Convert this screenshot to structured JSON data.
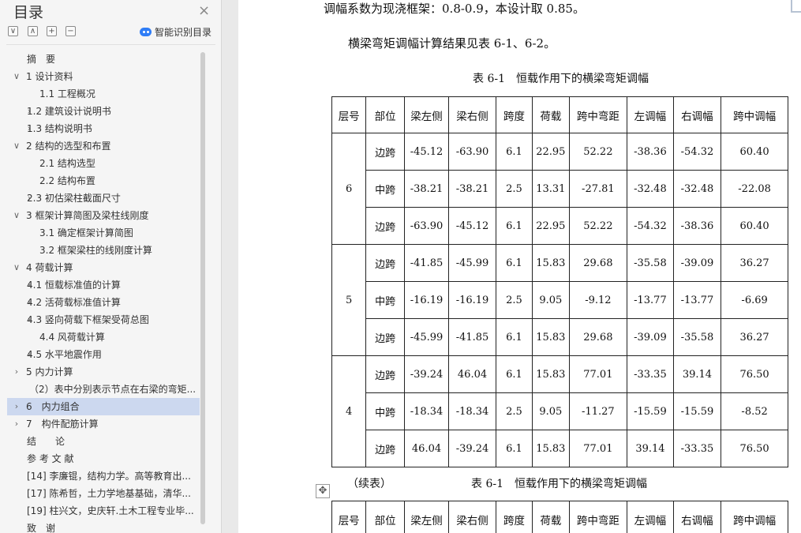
{
  "outline": {
    "title": "目录",
    "close_icon": "×",
    "toolbar_icons": [
      "∨",
      "∧",
      "+",
      "−"
    ],
    "smart_label": "智能识别目录",
    "items": [
      {
        "label": "摘　要",
        "level": 1,
        "arrow": ""
      },
      {
        "label": "1 设计资料",
        "level": 0,
        "arrow": "∨"
      },
      {
        "label": "1.1 工程概况",
        "level": 2,
        "arrow": ""
      },
      {
        "label": "1.2 建筑设计说明书",
        "level": 1,
        "arrow": "›"
      },
      {
        "label": "1.3 结构说明书",
        "level": 1,
        "arrow": "›"
      },
      {
        "label": "2 结构的选型和布置",
        "level": 0,
        "arrow": "∨"
      },
      {
        "label": "2.1 结构选型",
        "level": 2,
        "arrow": ""
      },
      {
        "label": "2.2 结构布置",
        "level": 2,
        "arrow": ""
      },
      {
        "label": "2.3 初估梁柱截面尺寸",
        "level": 1,
        "arrow": "›"
      },
      {
        "label": "3 框架计算简图及梁柱线刚度",
        "level": 0,
        "arrow": "∨"
      },
      {
        "label": "3.1 确定框架计算简图",
        "level": 2,
        "arrow": ""
      },
      {
        "label": "3.2 框架梁柱的线刚度计算",
        "level": 2,
        "arrow": ""
      },
      {
        "label": "4 荷载计算",
        "level": 0,
        "arrow": "∨"
      },
      {
        "label": "4.1 恒载标准值的计算",
        "level": 1,
        "arrow": "›"
      },
      {
        "label": "4.2 活荷载标准值计算",
        "level": 1,
        "arrow": "›"
      },
      {
        "label": "4.3 竖向荷载下框架受荷总图",
        "level": 1,
        "arrow": "›"
      },
      {
        "label": "4.4 风荷载计算",
        "level": 2,
        "arrow": ""
      },
      {
        "label": "4.5 水平地震作用",
        "level": 1,
        "arrow": "›"
      },
      {
        "label": "5 内力计算",
        "level": 0,
        "arrow": "›"
      },
      {
        "label": "（2）表中分别表示节点在右梁的弯矩...",
        "level": 3,
        "arrow": ""
      },
      {
        "label": "6　内力组合",
        "level": 0,
        "arrow": "›",
        "selected": true
      },
      {
        "label": "7　构件配筋计算",
        "level": 0,
        "arrow": "›"
      },
      {
        "label": "结　　论",
        "level": 1,
        "arrow": ""
      },
      {
        "label": "参 考 文 献",
        "level": 1,
        "arrow": ""
      },
      {
        "label": "[14] 李廉锟，结构力学。高等教育出...",
        "level": 1,
        "arrow": ""
      },
      {
        "label": "[17] 陈希哲，土力学地基基础，清华...",
        "level": 1,
        "arrow": ""
      },
      {
        "label": "[19] 柱兴文，史庆轩.土木工程专业毕...",
        "level": 1,
        "arrow": ""
      },
      {
        "label": "致　谢",
        "level": 1,
        "arrow": ""
      }
    ]
  },
  "document": {
    "line1": "调幅系数为现浇框架：0.8-0.9，本设计取 0.85。",
    "line2": "横梁弯矩调幅计算结果见表 6-1、6-2。",
    "table_title": "表 6-1　恒载作用下的横梁弯矩调幅",
    "continued_label": "（续表）",
    "continued_title": "表 6-1　恒载作用下的横梁弯矩调幅",
    "move_icon": "✥",
    "headers": [
      "层号",
      "部位",
      "梁左侧",
      "梁右侧",
      "跨度",
      "荷载",
      "跨中弯距",
      "左调幅",
      "右调幅",
      "跨中调幅"
    ],
    "floors": [
      {
        "floor": "6",
        "rows": [
          [
            "边跨",
            "-45.12",
            "-63.90",
            "6.1",
            "22.95",
            "52.22",
            "-38.36",
            "-54.32",
            "60.40"
          ],
          [
            "中跨",
            "-38.21",
            "-38.21",
            "2.5",
            "13.31",
            "-27.81",
            "-32.48",
            "-32.48",
            "-22.08"
          ],
          [
            "边跨",
            "-63.90",
            "-45.12",
            "6.1",
            "22.95",
            "52.22",
            "-54.32",
            "-38.36",
            "60.40"
          ]
        ]
      },
      {
        "floor": "5",
        "rows": [
          [
            "边跨",
            "-41.85",
            "-45.99",
            "6.1",
            "15.83",
            "29.68",
            "-35.58",
            "-39.09",
            "36.27"
          ],
          [
            "中跨",
            "-16.19",
            "-16.19",
            "2.5",
            "9.05",
            "-9.12",
            "-13.77",
            "-13.77",
            "-6.69"
          ],
          [
            "边跨",
            "-45.99",
            "-41.85",
            "6.1",
            "15.83",
            "29.68",
            "-39.09",
            "-35.58",
            "36.27"
          ]
        ]
      },
      {
        "floor": "4",
        "rows": [
          [
            "边跨",
            "-39.24",
            "46.04",
            "6.1",
            "15.83",
            "77.01",
            "-33.35",
            "39.14",
            "76.50"
          ],
          [
            "中跨",
            "-18.34",
            "-18.34",
            "2.5",
            "9.05",
            "-11.27",
            "-15.59",
            "-15.59",
            "-8.52"
          ],
          [
            "边跨",
            "46.04",
            "-39.24",
            "6.1",
            "15.83",
            "77.01",
            "39.14",
            "-33.35",
            "76.50"
          ]
        ]
      }
    ]
  }
}
